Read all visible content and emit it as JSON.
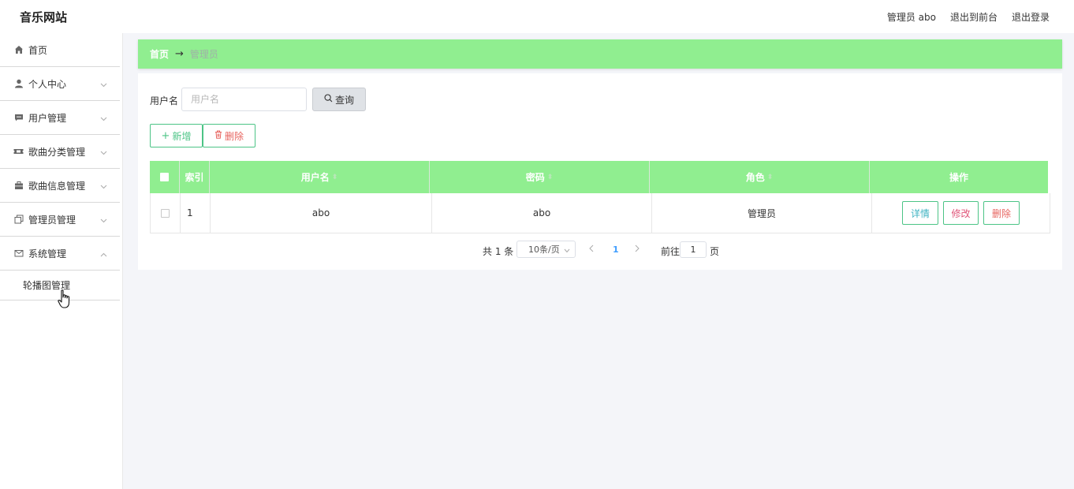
{
  "header": {
    "brand": "音乐网站",
    "user": "管理员 abo",
    "to_front": "退出到前台",
    "logout": "退出登录"
  },
  "sidebar": {
    "items": [
      {
        "label": "首页",
        "icon": "home-icon"
      },
      {
        "label": "个人中心",
        "icon": "user-icon"
      },
      {
        "label": "用户管理",
        "icon": "chat-icon"
      },
      {
        "label": "歌曲分类管理",
        "icon": "ticket-icon"
      },
      {
        "label": "歌曲信息管理",
        "icon": "briefcase-icon"
      },
      {
        "label": "管理员管理",
        "icon": "copy-icon"
      },
      {
        "label": "系统管理",
        "icon": "mail-icon"
      }
    ],
    "submenu": [
      {
        "label": "轮播图管理"
      }
    ]
  },
  "breadcrumb": {
    "home": "首页",
    "arrow": "→",
    "current": "管理员"
  },
  "search": {
    "label": "用户名",
    "placeholder": "用户名",
    "button": "查询"
  },
  "actions": {
    "add": "新增",
    "delete": "删除"
  },
  "table": {
    "columns": [
      "索引",
      "用户名",
      "密码",
      "角色",
      "操作"
    ],
    "rows": [
      {
        "index": "1",
        "username": "abo",
        "password": "abo",
        "role": "管理员"
      }
    ],
    "row_actions": {
      "detail": "详情",
      "edit": "修改",
      "delete": "删除"
    }
  },
  "pagination": {
    "total": "共 1 条",
    "page_size": "10条/页",
    "current_page": "1",
    "goto_label": "前往",
    "goto_value": "1",
    "goto_unit": "页"
  },
  "colors": {
    "accent_green": "#90ee90",
    "button_border": "#4cc486",
    "danger": "#e7645f",
    "edit": "#e0567a",
    "detail": "#3fb3c2",
    "page_active": "#409eff"
  }
}
